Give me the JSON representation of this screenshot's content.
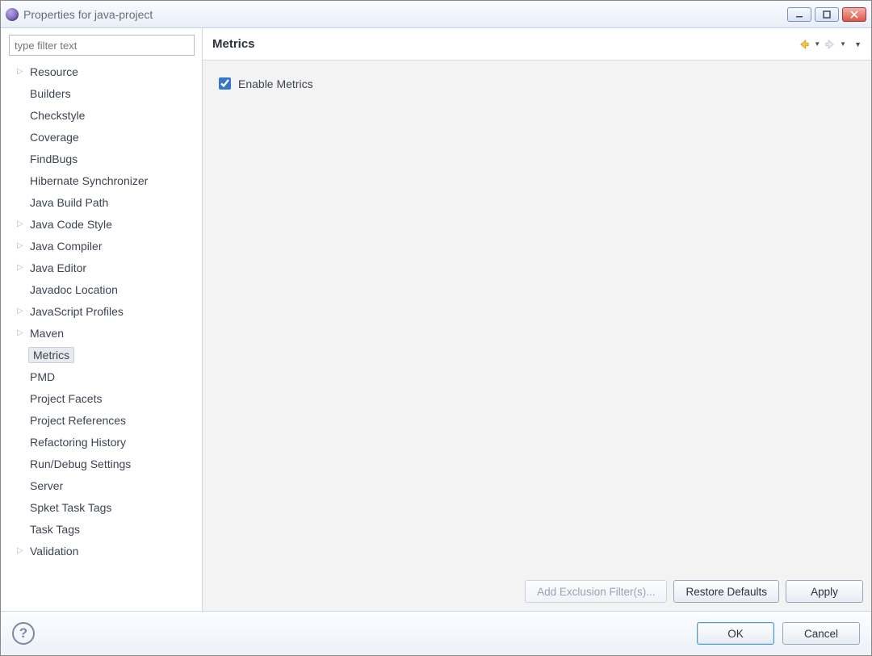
{
  "window": {
    "title": "Properties for java-project"
  },
  "sidebar": {
    "filter_placeholder": "type filter text",
    "items": [
      {
        "label": "Resource",
        "has_children": true,
        "selected": false
      },
      {
        "label": "Builders",
        "has_children": false,
        "selected": false
      },
      {
        "label": "Checkstyle",
        "has_children": false,
        "selected": false
      },
      {
        "label": "Coverage",
        "has_children": false,
        "selected": false
      },
      {
        "label": "FindBugs",
        "has_children": false,
        "selected": false
      },
      {
        "label": "Hibernate Synchronizer",
        "has_children": false,
        "selected": false
      },
      {
        "label": "Java Build Path",
        "has_children": false,
        "selected": false
      },
      {
        "label": "Java Code Style",
        "has_children": true,
        "selected": false
      },
      {
        "label": "Java Compiler",
        "has_children": true,
        "selected": false
      },
      {
        "label": "Java Editor",
        "has_children": true,
        "selected": false
      },
      {
        "label": "Javadoc Location",
        "has_children": false,
        "selected": false
      },
      {
        "label": "JavaScript Profiles",
        "has_children": true,
        "selected": false
      },
      {
        "label": "Maven",
        "has_children": true,
        "selected": false
      },
      {
        "label": "Metrics",
        "has_children": false,
        "selected": true
      },
      {
        "label": "PMD",
        "has_children": false,
        "selected": false
      },
      {
        "label": "Project Facets",
        "has_children": false,
        "selected": false
      },
      {
        "label": "Project References",
        "has_children": false,
        "selected": false
      },
      {
        "label": "Refactoring History",
        "has_children": false,
        "selected": false
      },
      {
        "label": "Run/Debug Settings",
        "has_children": false,
        "selected": false
      },
      {
        "label": "Server",
        "has_children": false,
        "selected": false
      },
      {
        "label": "Spket Task Tags",
        "has_children": false,
        "selected": false
      },
      {
        "label": "Task Tags",
        "has_children": false,
        "selected": false
      },
      {
        "label": "Validation",
        "has_children": true,
        "selected": false
      }
    ]
  },
  "main": {
    "title": "Metrics",
    "enable_metrics_label": "Enable Metrics",
    "enable_metrics_checked": true,
    "buttons": {
      "add_exclusion": "Add Exclusion Filter(s)...",
      "restore_defaults": "Restore Defaults",
      "apply": "Apply"
    }
  },
  "footer": {
    "ok": "OK",
    "cancel": "Cancel"
  }
}
